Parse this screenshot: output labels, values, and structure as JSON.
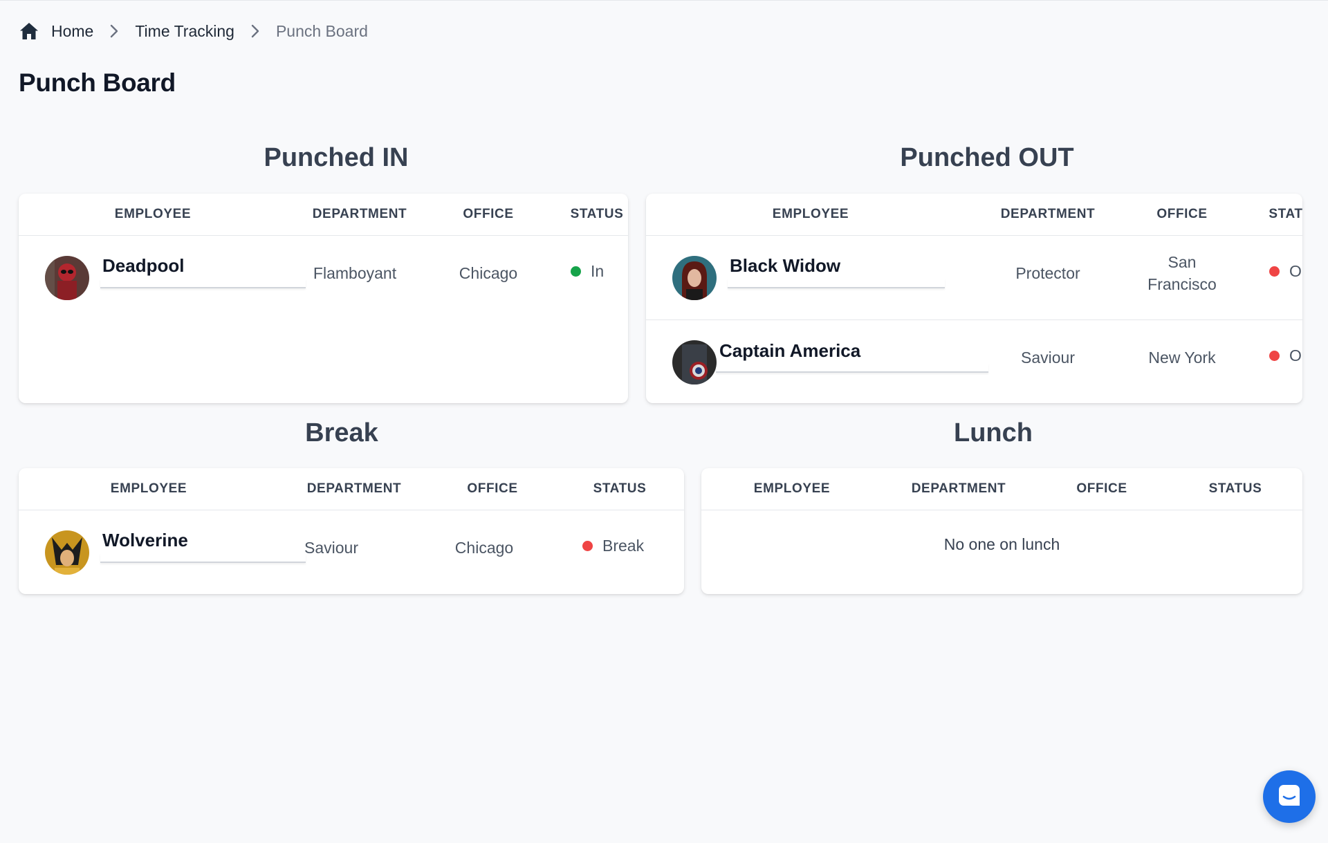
{
  "breadcrumb": {
    "home": "Home",
    "time_tracking": "Time Tracking",
    "current": "Punch Board"
  },
  "page_title": "Punch Board",
  "sections": {
    "punched_in": {
      "title": "Punched IN",
      "columns": [
        "EMPLOYEE",
        "DEPARTMENT",
        "OFFICE",
        "STATUS"
      ],
      "rows": [
        {
          "name": "Deadpool",
          "department": "Flamboyant",
          "office": "Chicago",
          "status": "In",
          "status_color": "#16a34a"
        }
      ]
    },
    "punched_out": {
      "title": "Punched OUT",
      "columns": [
        "EMPLOYEE",
        "DEPARTMENT",
        "OFFICE",
        "STAT"
      ],
      "rows": [
        {
          "name": "Black Widow",
          "department": "Protector",
          "office_line1": "San",
          "office_line2": "Francisco",
          "status": "O",
          "status_color": "#ef4444"
        },
        {
          "name": "Captain America",
          "department": "Saviour",
          "office": "New York",
          "status": "O",
          "status_color": "#ef4444"
        }
      ]
    },
    "break": {
      "title": "Break",
      "columns": [
        "EMPLOYEE",
        "DEPARTMENT",
        "OFFICE",
        "STATUS"
      ],
      "rows": [
        {
          "name": "Wolverine",
          "department": "Saviour",
          "office": "Chicago",
          "status": "Break",
          "status_color": "#ef4444"
        }
      ]
    },
    "lunch": {
      "title": "Lunch",
      "columns": [
        "EMPLOYEE",
        "DEPARTMENT",
        "OFFICE",
        "STATUS"
      ],
      "empty_message": "No one on lunch"
    }
  },
  "icons": {
    "home": "home-icon",
    "separator": "chevron-right-icon",
    "chat": "chat-icon"
  },
  "colors": {
    "accent": "#1e6fe8",
    "status_in": "#16a34a",
    "status_out": "#ef4444"
  }
}
